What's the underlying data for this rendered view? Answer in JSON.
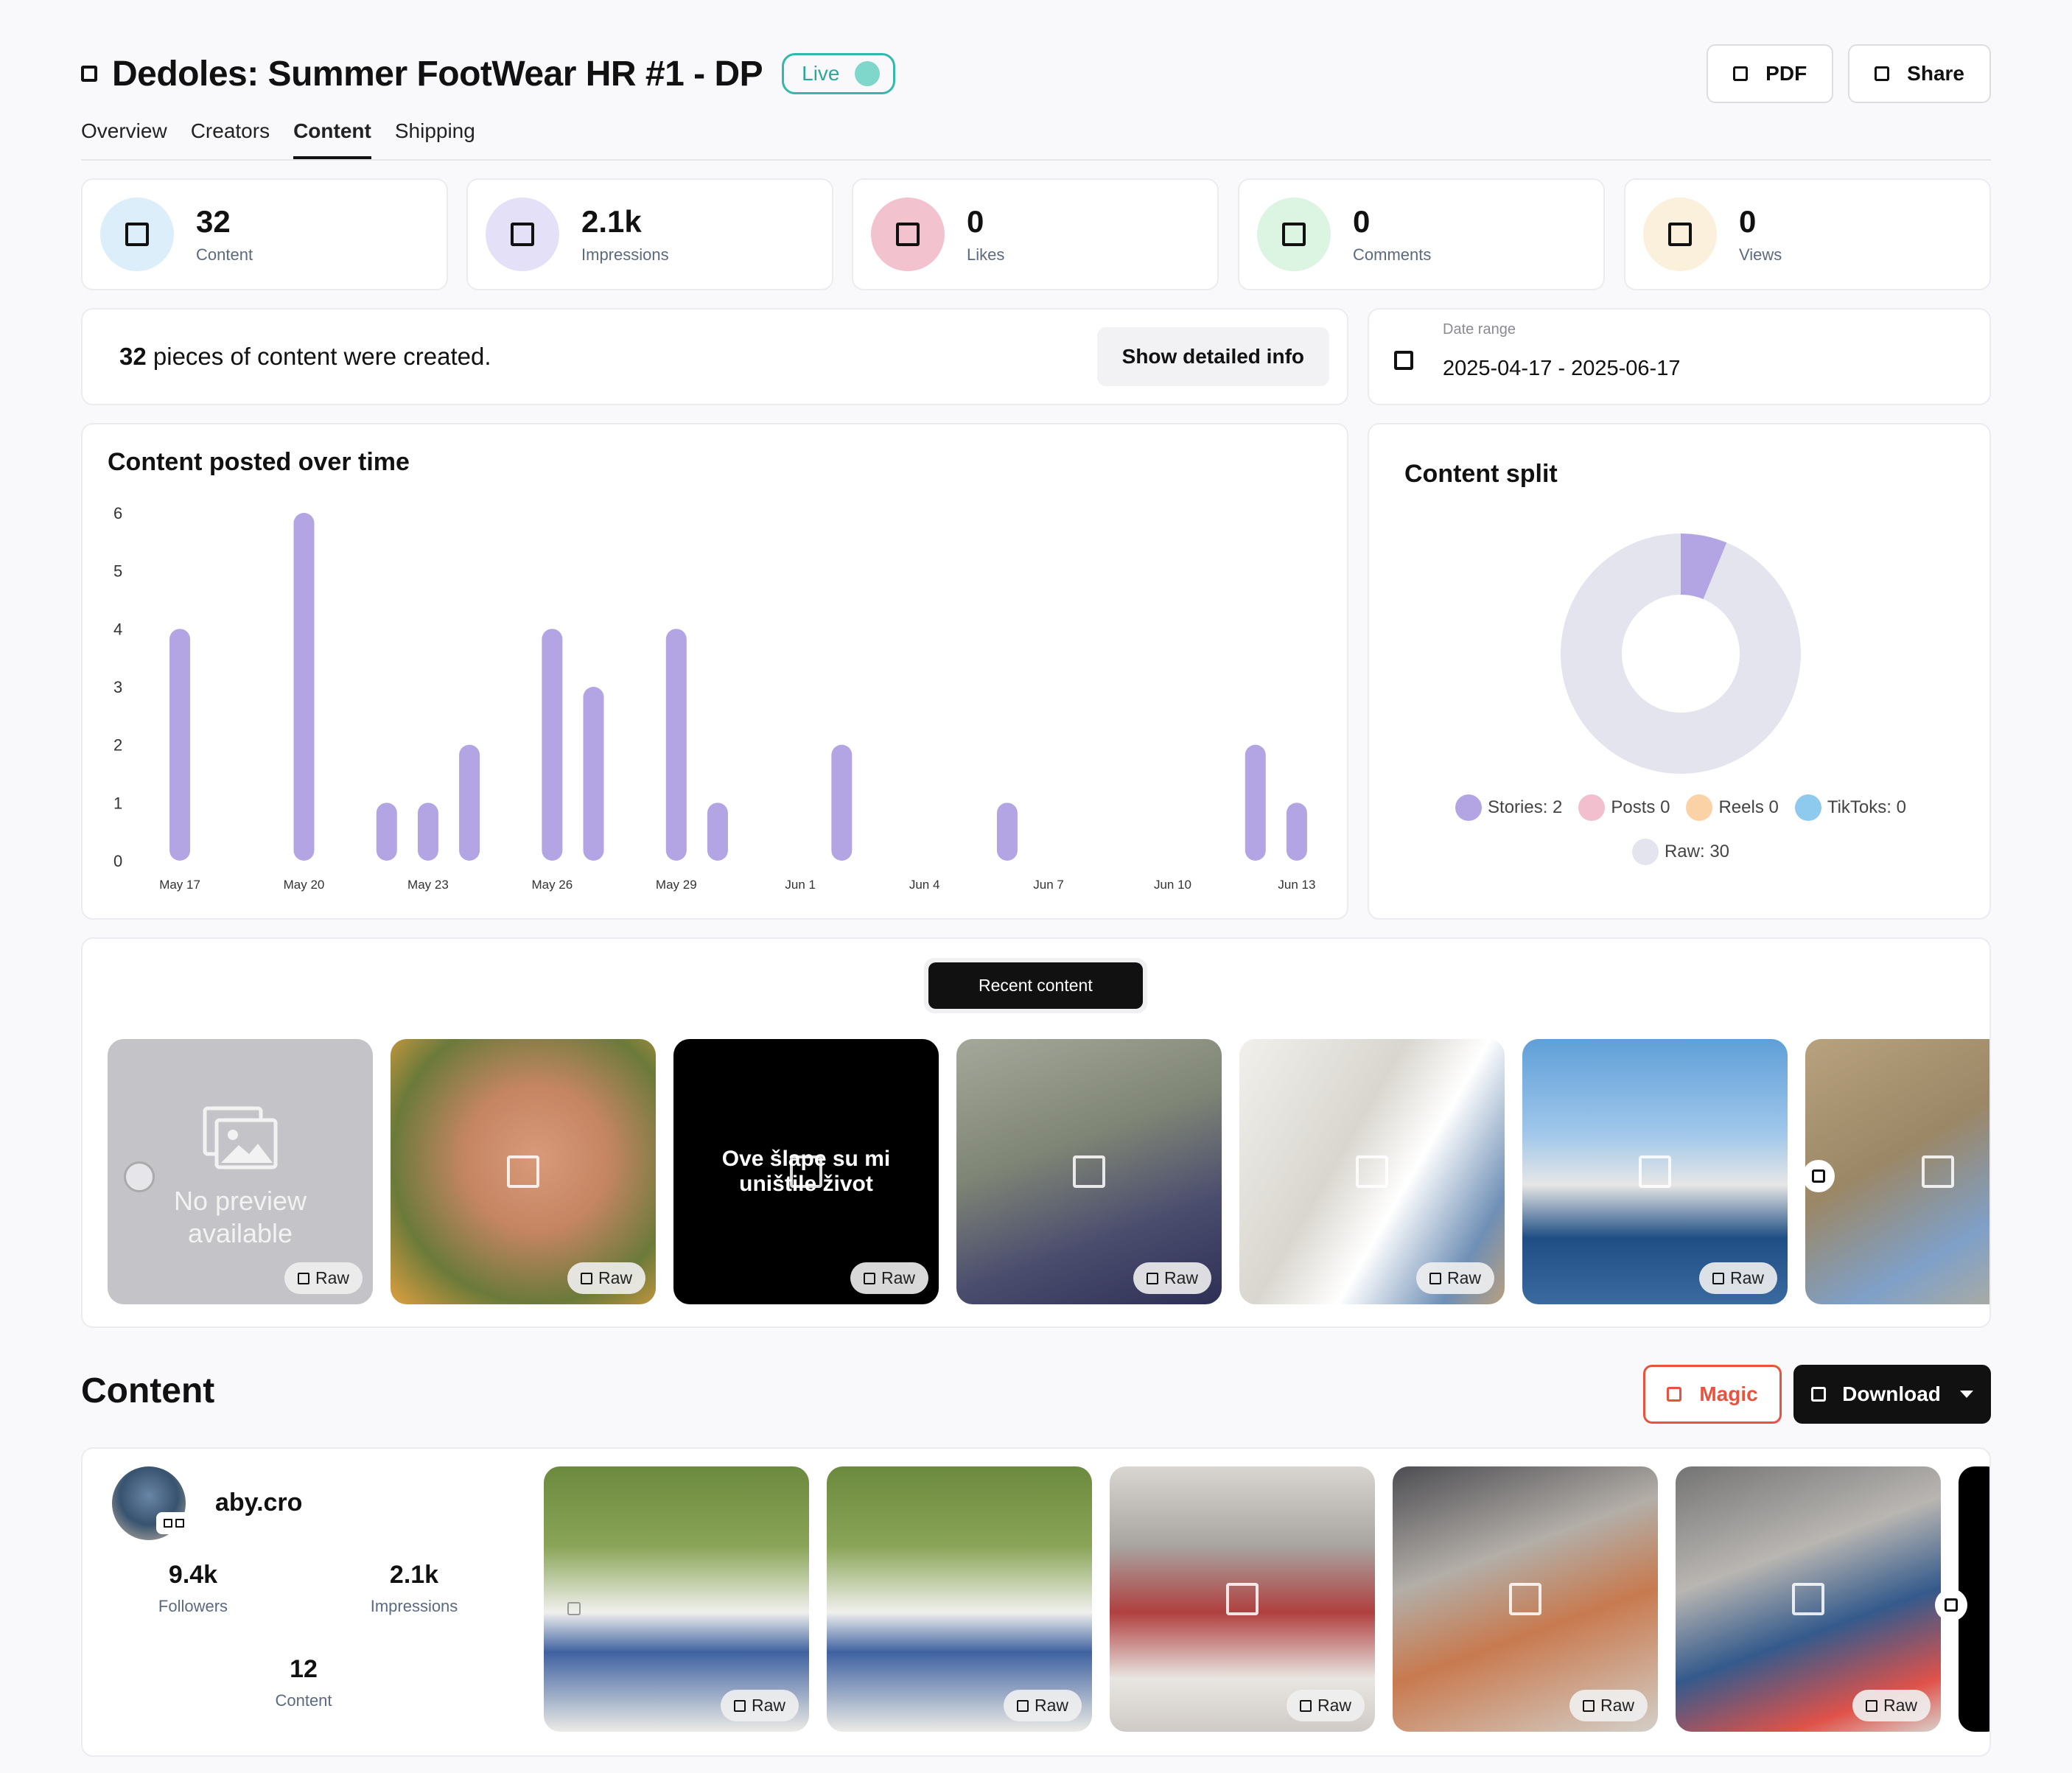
{
  "header": {
    "title": "Dedoles: Summer FootWear HR #1 - DP",
    "status": "Live",
    "pdf_label": "PDF",
    "share_label": "Share"
  },
  "tabs": [
    "Overview",
    "Creators",
    "Content",
    "Shipping"
  ],
  "active_tab": "Content",
  "stats": [
    {
      "value": "32",
      "label": "Content",
      "color": "#dbeefa"
    },
    {
      "value": "2.1k",
      "label": "Impressions",
      "color": "#e4e0f8"
    },
    {
      "value": "0",
      "label": "Likes",
      "color": "#f2c2cf"
    },
    {
      "value": "0",
      "label": "Comments",
      "color": "#dcf4e2"
    },
    {
      "value": "0",
      "label": "Views",
      "color": "#fbf0dc"
    }
  ],
  "summary": {
    "count": "32",
    "text": " pieces of content were created.",
    "button_label": "Show detailed info"
  },
  "date_range": {
    "label": "Date range",
    "value": "2025-04-17 - 2025-06-17"
  },
  "chart_data": [
    {
      "type": "bar",
      "title": "Content posted over time",
      "x": [
        "May 17",
        "May 18",
        "May 19",
        "May 20",
        "May 21",
        "May 22",
        "May 23",
        "May 24",
        "May 25",
        "May 26",
        "May 27",
        "May 28",
        "May 29",
        "May 30",
        "May 31",
        "Jun 1",
        "Jun 2",
        "Jun 3",
        "Jun 4",
        "Jun 5",
        "Jun 6",
        "Jun 7",
        "Jun 8",
        "Jun 9",
        "Jun 10",
        "Jun 11",
        "Jun 12",
        "Jun 13"
      ],
      "values": [
        4,
        0,
        0,
        6,
        0,
        1,
        1,
        2,
        0,
        4,
        3,
        0,
        4,
        1,
        0,
        0,
        2,
        0,
        0,
        0,
        1,
        0,
        0,
        0,
        0,
        0,
        2,
        1
      ],
      "xticks": [
        "May 17",
        "May 20",
        "May 23",
        "May 26",
        "May 29",
        "Jun 1",
        "Jun 4",
        "Jun 7",
        "Jun 10",
        "Jun 13"
      ],
      "yticks": [
        0,
        1,
        2,
        3,
        4,
        5,
        6
      ],
      "ylim": [
        0,
        6
      ],
      "grid": false,
      "color": "#b3a5e3"
    },
    {
      "type": "pie",
      "title": "Content split",
      "slices": [
        {
          "label": "Stories",
          "value": 2,
          "color": "#b3a5e3",
          "legend": "Stories: 2"
        },
        {
          "label": "Posts",
          "value": 0,
          "color": "#f2bfcf",
          "legend": "Posts 0"
        },
        {
          "label": "Reels",
          "value": 0,
          "color": "#fbd2a6",
          "legend": "Reels 0"
        },
        {
          "label": "TikToks",
          "value": 0,
          "color": "#8ec9ee",
          "legend": "TikToks: 0"
        },
        {
          "label": "Raw",
          "value": 30,
          "color": "#e4e4ef",
          "legend": "Raw: 30"
        }
      ],
      "donut": true
    }
  ],
  "recent": {
    "tab_label": "Recent content",
    "no_preview_line1": "No preview",
    "no_preview_line2": "available",
    "black_text_line1": "Ove šlape su mi",
    "black_text_line2": "uništile život",
    "raw_label": "Raw"
  },
  "content_section": {
    "heading": "Content",
    "magic_label": "Magic",
    "download_label": "Download"
  },
  "creator": {
    "name": "aby.cro",
    "followers_value": "9.4k",
    "followers_label": "Followers",
    "impressions_value": "2.1k",
    "impressions_label": "Impressions",
    "content_value": "12",
    "content_label": "Content"
  }
}
